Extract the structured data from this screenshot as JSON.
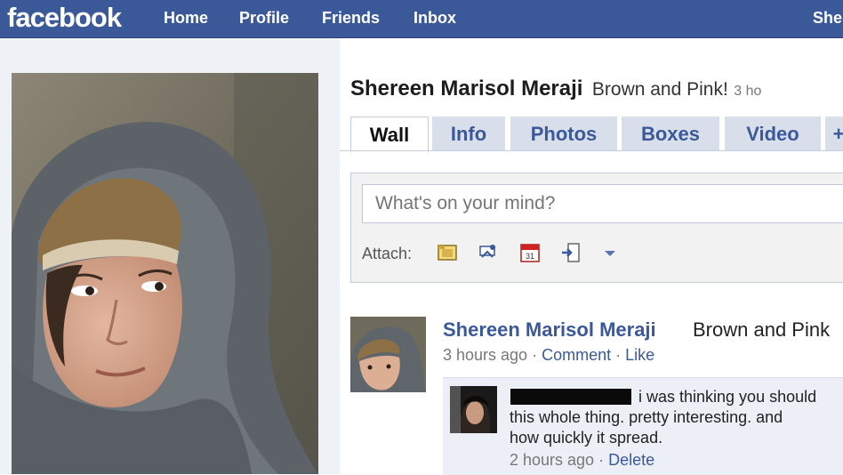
{
  "brand": {
    "logo": "facebook",
    "bar_color": "#3b5998",
    "link_color": "#3b5998"
  },
  "nav": {
    "home": "Home",
    "profile": "Profile",
    "friends": "Friends",
    "inbox": "Inbox",
    "user": "She"
  },
  "profile": {
    "name": "Shereen Marisol Meraji",
    "status": "Brown and Pink!",
    "status_time": "3 ho",
    "photo": "woman-in-knit-hat-and-scarf"
  },
  "tabs": [
    {
      "label": "Wall",
      "active": true
    },
    {
      "label": "Info"
    },
    {
      "label": "Photos"
    },
    {
      "label": "Boxes"
    },
    {
      "label": "Video"
    },
    {
      "label": "+"
    }
  ],
  "publisher": {
    "placeholder": "What's on your mind?",
    "attach_label": "Attach:",
    "attach_icons": [
      "photo-icon",
      "link-icon",
      "event-icon",
      "share-icon",
      "dropdown-arrow-icon"
    ]
  },
  "post": {
    "author": "Shereen Marisol Meraji",
    "text": "Brown and Pink",
    "time": "3 hours ago",
    "sep": "·",
    "comment_link": "Comment",
    "like_link": "Like"
  },
  "comment": {
    "line1": "i was thinking you should",
    "line2": "this whole thing. pretty interesting. and",
    "line3": "how quickly it spread.",
    "time": "2 hours ago",
    "sep": "·",
    "delete_link": "Delete",
    "author_redacted": true
  }
}
